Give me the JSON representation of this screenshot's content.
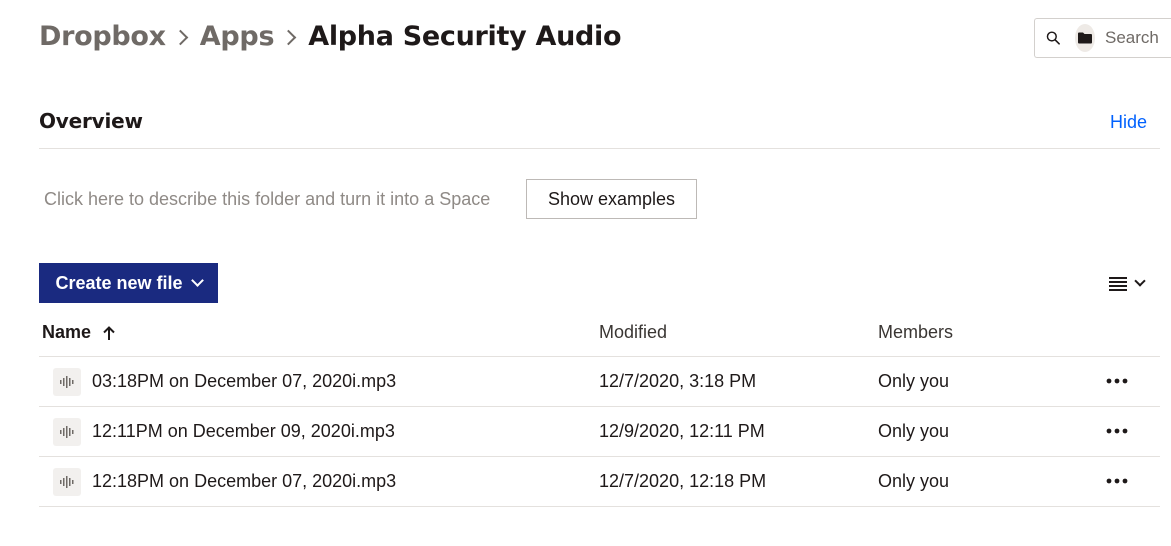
{
  "breadcrumb": {
    "items": [
      "Dropbox",
      "Apps"
    ],
    "current": "Alpha Security Audio"
  },
  "search": {
    "placeholder": "Search",
    "icon": "search-icon",
    "scope_icon": "folder-icon"
  },
  "overview": {
    "title": "Overview",
    "hide_label": "Hide",
    "describe_text": "Click here to describe this folder and turn it into a Space",
    "show_examples_label": "Show examples"
  },
  "toolbar": {
    "create_label": "Create new file",
    "view_icon": "list-view-icon"
  },
  "table": {
    "columns": {
      "name": "Name",
      "modified": "Modified",
      "members": "Members"
    },
    "rows": [
      {
        "name": "03:18PM on December 07, 2020i.mp3",
        "modified": "12/7/2020, 3:18 PM",
        "members": "Only you"
      },
      {
        "name": "12:11PM on December 09, 2020i.mp3",
        "modified": "12/9/2020, 12:11 PM",
        "members": "Only you"
      },
      {
        "name": "12:18PM on December 07, 2020i.mp3",
        "modified": "12/7/2020, 12:18 PM",
        "members": "Only you"
      }
    ]
  },
  "colors": {
    "primary_button": "#1a2a80",
    "link": "#0061fe",
    "breadcrumb_muted": "#6f6a66",
    "text": "#1e1919"
  }
}
